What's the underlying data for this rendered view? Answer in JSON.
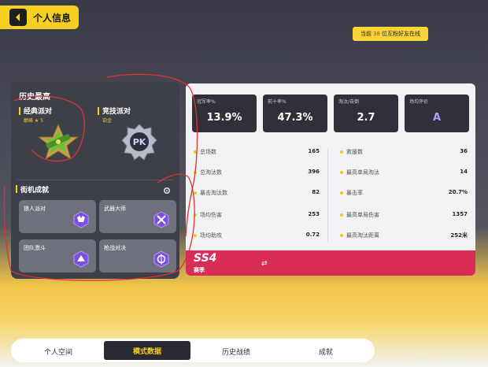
{
  "header": {
    "title": "个人信息"
  },
  "rank_notice": {
    "prefix": "当前",
    "value": "38",
    "suffix": "位互粉好友在线"
  },
  "left_panel": {
    "heading": "历史最高",
    "modes": [
      {
        "name": "经典派对",
        "rank": "巅峰 ★ 5"
      },
      {
        "name": "竞技派对",
        "rank": "铂金"
      }
    ],
    "arcade": {
      "heading": "街机成就",
      "tiles": [
        "狼人派对",
        "武器大师",
        "团队激斗",
        "枪战对决"
      ]
    }
  },
  "stats": {
    "cards": [
      {
        "label": "冠军率%",
        "value": "13.9%"
      },
      {
        "label": "前十率%",
        "value": "47.3%"
      },
      {
        "label": "淘汰/击倒",
        "value": "2.7"
      },
      {
        "label": "场均评价",
        "value": "A"
      }
    ],
    "left_rows": [
      {
        "name": "总场数",
        "value": "165"
      },
      {
        "name": "总淘汰数",
        "value": "396"
      },
      {
        "name": "暴击淘汰数",
        "value": "82"
      },
      {
        "name": "场均伤害",
        "value": "253"
      },
      {
        "name": "场均助攻",
        "value": "0.72"
      }
    ],
    "right_rows": [
      {
        "name": "救援数",
        "value": "36"
      },
      {
        "name": "最高单局淘汰",
        "value": "14"
      },
      {
        "name": "暴击率",
        "value": "20.7%"
      },
      {
        "name": "最高单局伤害",
        "value": "1357"
      },
      {
        "name": "最高淘汰距离",
        "value": "252米"
      }
    ]
  },
  "season": {
    "code": "SS4",
    "label": "赛季"
  },
  "nav": {
    "tabs": [
      "个人空间",
      "模式数据",
      "历史战绩",
      "成就"
    ],
    "active": "模式数据"
  },
  "version": "1-9vaqm-13.4.1315258",
  "colors": {
    "accent": "#f6cf20",
    "season": "#d82d57",
    "panel": "#3d3f49",
    "annotation": "#e03030"
  }
}
